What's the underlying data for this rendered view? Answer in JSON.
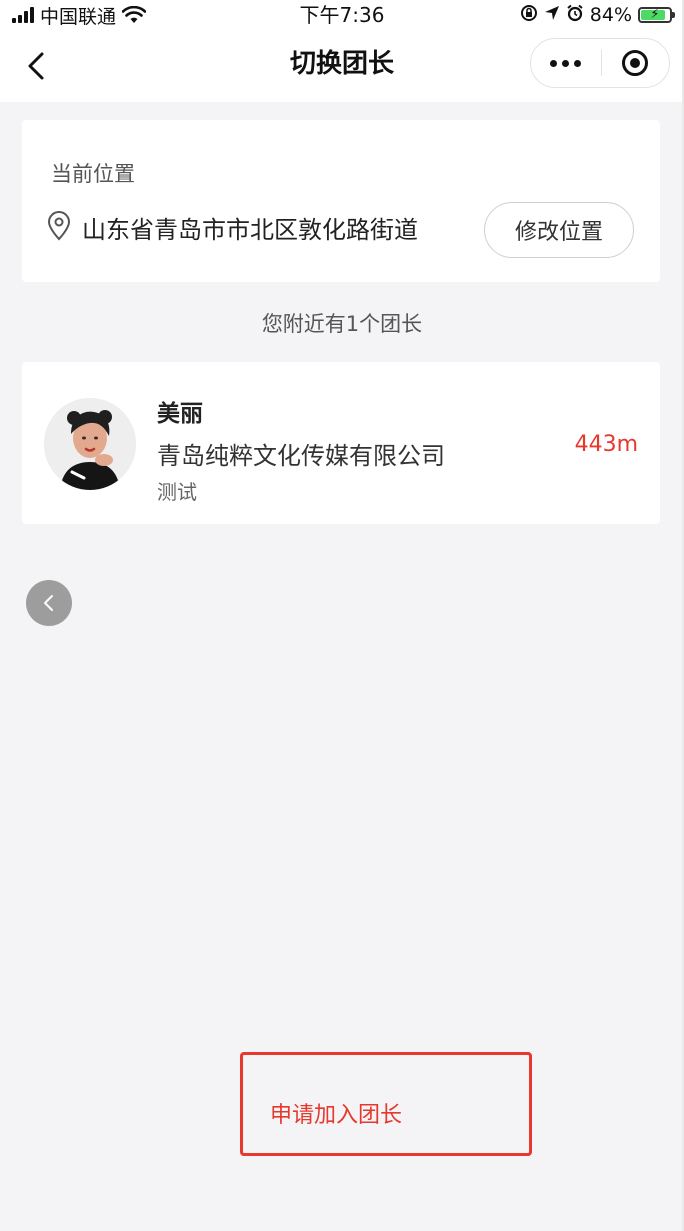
{
  "status_bar": {
    "carrier": "中国联通",
    "time": "下午7:36",
    "battery_percent": "84%",
    "battery_level": 0.84
  },
  "nav": {
    "title": "切换团长"
  },
  "location": {
    "label": "当前位置",
    "address": "山东省青岛市市北区敦化路街道",
    "modify_button": "修改位置"
  },
  "nearby": {
    "summary": "您附近有1个团长"
  },
  "leaders": [
    {
      "name": "美丽",
      "company": "青岛纯粹文化传媒有限公司",
      "note": "测试",
      "distance": "443m"
    }
  ],
  "footer": {
    "apply_label": "申请加入团长"
  },
  "colors": {
    "accent": "#e6382d",
    "background": "#f4f4f6"
  }
}
